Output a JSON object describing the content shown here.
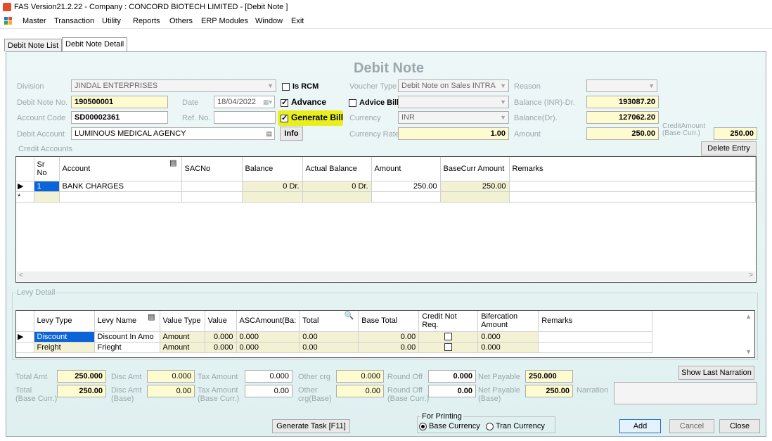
{
  "window": {
    "title": "FAS Version21.2.22 - Company : CONCORD BIOTECH LIMITED - [Debit Note ]"
  },
  "menu": [
    {
      "label": "Master",
      "key": "M"
    },
    {
      "label": "Transaction",
      "key": "T"
    },
    {
      "label": "Utility",
      "key": "U"
    },
    {
      "label": "Reports",
      "key": "R"
    },
    {
      "label": "Others",
      "key": "O"
    },
    {
      "label": "ERP Modules",
      "key": "E"
    },
    {
      "label": "Window",
      "key": "W"
    },
    {
      "label": "Exit",
      "key": "x"
    }
  ],
  "tabs": [
    "Debit Note List",
    "Debit Note Detail"
  ],
  "form": {
    "heading": "Debit Note",
    "division_label": "Division",
    "division_value": "JINDAL ENTERPRISES",
    "is_rcm_label": "Is RCM",
    "voucher_type_label": "Voucher Type",
    "voucher_type_value": "Debit Note on Sales INTRA",
    "reason_label": "Reason",
    "reason_value": "",
    "debit_note_no_label": "Debit Note No.",
    "debit_note_no_value": "190500001",
    "date_label": "Date",
    "date_value": "18/04/2022",
    "advance_label": "Advance",
    "advice_bill_label": "Advice Bill",
    "advice_bill_value": "",
    "balance_inr_label": "Balance (INR)-Dr.",
    "balance_inr_value": "193087.20",
    "account_code_label": "Account Code",
    "account_code_value": "SD00002361",
    "ref_no_label": "Ref. No.",
    "ref_no_value": "",
    "generate_bill_label": "Generate Bill",
    "currency_label": "Currency",
    "currency_value": "INR",
    "balance_dr_label": "Balance(Dr).",
    "balance_dr_value": "127062.20",
    "debit_account_label": "Debit Account",
    "debit_account_value": "LUMINOUS MEDICAL AGENCY",
    "info_label": "Info",
    "currency_rate_label": "Currency Rate",
    "currency_rate_value": "1.00",
    "amount_label": "Amount",
    "amount_value": "250.00",
    "credit_amount_label": "CreditAmount",
    "credit_amount_sub": "(Base Curr.)",
    "credit_amount_value": "250.00",
    "credit_accounts_label": "Credit Accounts",
    "delete_entry_label": "Delete Entry"
  },
  "credit_grid": {
    "headers": [
      "Sr No",
      "Account",
      "SACNo",
      "Balance",
      "Actual Balance",
      "Amount",
      "BaseCurr Amount",
      "Remarks"
    ],
    "rows": [
      {
        "sr": "1",
        "account": "BANK CHARGES",
        "sac": "",
        "balance": "0 Dr.",
        "actual": "0 Dr.",
        "amount": "250.00",
        "base": "250.00",
        "remarks": ""
      }
    ],
    "new_row_marker": "*"
  },
  "levy": {
    "label": "Levy Detail",
    "headers": [
      "Levy Type",
      "Levy Name",
      "Value Type",
      "Value",
      "ASCAmount(Ba:",
      "Total",
      "Base Total",
      "Credit Not Req.",
      "Bifercation Amount",
      "Remarks"
    ],
    "rows": [
      {
        "type": "Discount",
        "name": "Discount In Amo",
        "vtype": "Amount",
        "value": "0.000",
        "asc": "0.000",
        "total": "0.00",
        "base": "0.00",
        "bif": "0.000",
        "remarks": ""
      },
      {
        "type": "Freight",
        "name": "Frieght",
        "vtype": "Amount",
        "value": "0.000",
        "asc": "0.000",
        "total": "0.00",
        "base": "0.00",
        "bif": "0.000",
        "remarks": ""
      }
    ]
  },
  "totals": {
    "total_amt_label": "Total Amt",
    "total_amt": "250.000",
    "disc_amt_label": "Disc Amt",
    "disc_amt": "0.000",
    "tax_amount_label": "Tax Amount",
    "tax_amount": "0.000",
    "other_crg_label": "Other crg",
    "other_crg": "0.000",
    "round_off_label": "Round Off",
    "round_off": "0.000",
    "net_payable_label": "Net Payable",
    "net_payable": "250.000",
    "show_last_narration_label": "Show Last Narration",
    "total_base_label": "Total",
    "total_base_sub": "(Base Curr.)",
    "total_base": "250.00",
    "disc_base_label": "Disc Amt",
    "disc_base_sub": "(Base)",
    "disc_base": "0.00",
    "tax_base_label": "Tax Amount",
    "tax_base_sub": "(Base Curr.)",
    "tax_base": "0.00",
    "other_base_label": "Other",
    "other_base_sub": "crg(Base)",
    "other_base": "0.00",
    "round_base_label": "Round Off",
    "round_base_sub": "(Base Curr.)",
    "round_base": "0.00",
    "net_base_label": "Net Payable",
    "net_base_sub": "(Base)",
    "net_base": "250.00",
    "narration_label": "Narration",
    "narration_value": ""
  },
  "footer": {
    "generate_task_label": "Generate Task [F11]",
    "for_printing_label": "For Printing",
    "base_currency_label": "Base Currency",
    "tran_currency_label": "Tran Currency",
    "add_label": "Add",
    "cancel_label": "Cancel",
    "close_label": "Close"
  },
  "colors": {
    "highlight": "#e9ef1f",
    "selection": "#0b64d8",
    "input_yellow": "#fffbd0",
    "panel": "#e6f4f4"
  }
}
